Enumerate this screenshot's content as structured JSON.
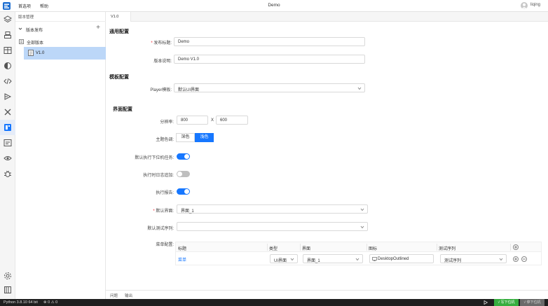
{
  "titlebar": {
    "menus": [
      "首选项",
      "帮助"
    ],
    "title": "Demo",
    "user": "liqing"
  },
  "colors": {
    "accent": "#1677ff",
    "selected_tree": "#bcd7f8",
    "statusbar": "#1f1f1f",
    "flash_button": "#36ad3e"
  },
  "activitybar": {
    "icons": [
      "layers-icon",
      "build-icon",
      "layout-icon",
      "theme-icon",
      "code-icon",
      "deploy-icon",
      "tools-icon",
      "version-icon",
      "template-icon",
      "monitor-icon",
      "debug-icon"
    ],
    "bottom_icons": [
      "settings-icon",
      "library-icon"
    ]
  },
  "sidebar": {
    "title": "版本管理",
    "section": "版本发布",
    "add": "+",
    "root": "全部版本",
    "selected_item": "V1.0"
  },
  "tab": {
    "label": "V1.0"
  },
  "general": {
    "title": "通用配置",
    "release_title_label": "发布标题:",
    "release_title_value": "Demo",
    "release_desc_label": "版本说明:",
    "release_desc_value": "Demo V1.0"
  },
  "template": {
    "title": "模板配置",
    "player_label": "Player模板:",
    "player_value": "默认UI界面"
  },
  "ui": {
    "title": "界面配置",
    "resolution_label": "分辨率:",
    "width": "800",
    "x": "X",
    "height": "600",
    "theme_label": "主题色调:",
    "theme_dark": "深色",
    "theme_light": "浅色",
    "auto_run_label": "默认执行下位机任务:",
    "append_log_label": "执行时日志追加:",
    "report_label": "执行报告:",
    "default_page_label": "默认界面:",
    "default_page_value": "界面_1",
    "default_seq_label": "默认测试序列:",
    "default_seq_value": "",
    "menu_config_label": "菜单配置:"
  },
  "toggles": {
    "auto_run": true,
    "append_log": false,
    "report": true
  },
  "menu_table": {
    "columns": [
      "标题",
      "类型",
      "界面",
      "图标",
      "测试序列"
    ],
    "rows": [
      {
        "title": "菜单",
        "type": "UI界面",
        "page": "界面_1",
        "icon": "DesktopOutlined",
        "sequence": "测试序列"
      }
    ]
  },
  "panel": {
    "tabs": [
      "问题",
      "输出"
    ]
  },
  "status": {
    "python": "Python 3.8.10 64 bit",
    "problems": "⊗ 0  ⚠ 0",
    "flash": "√ 写下位机",
    "stop": "√ 停下位机"
  }
}
